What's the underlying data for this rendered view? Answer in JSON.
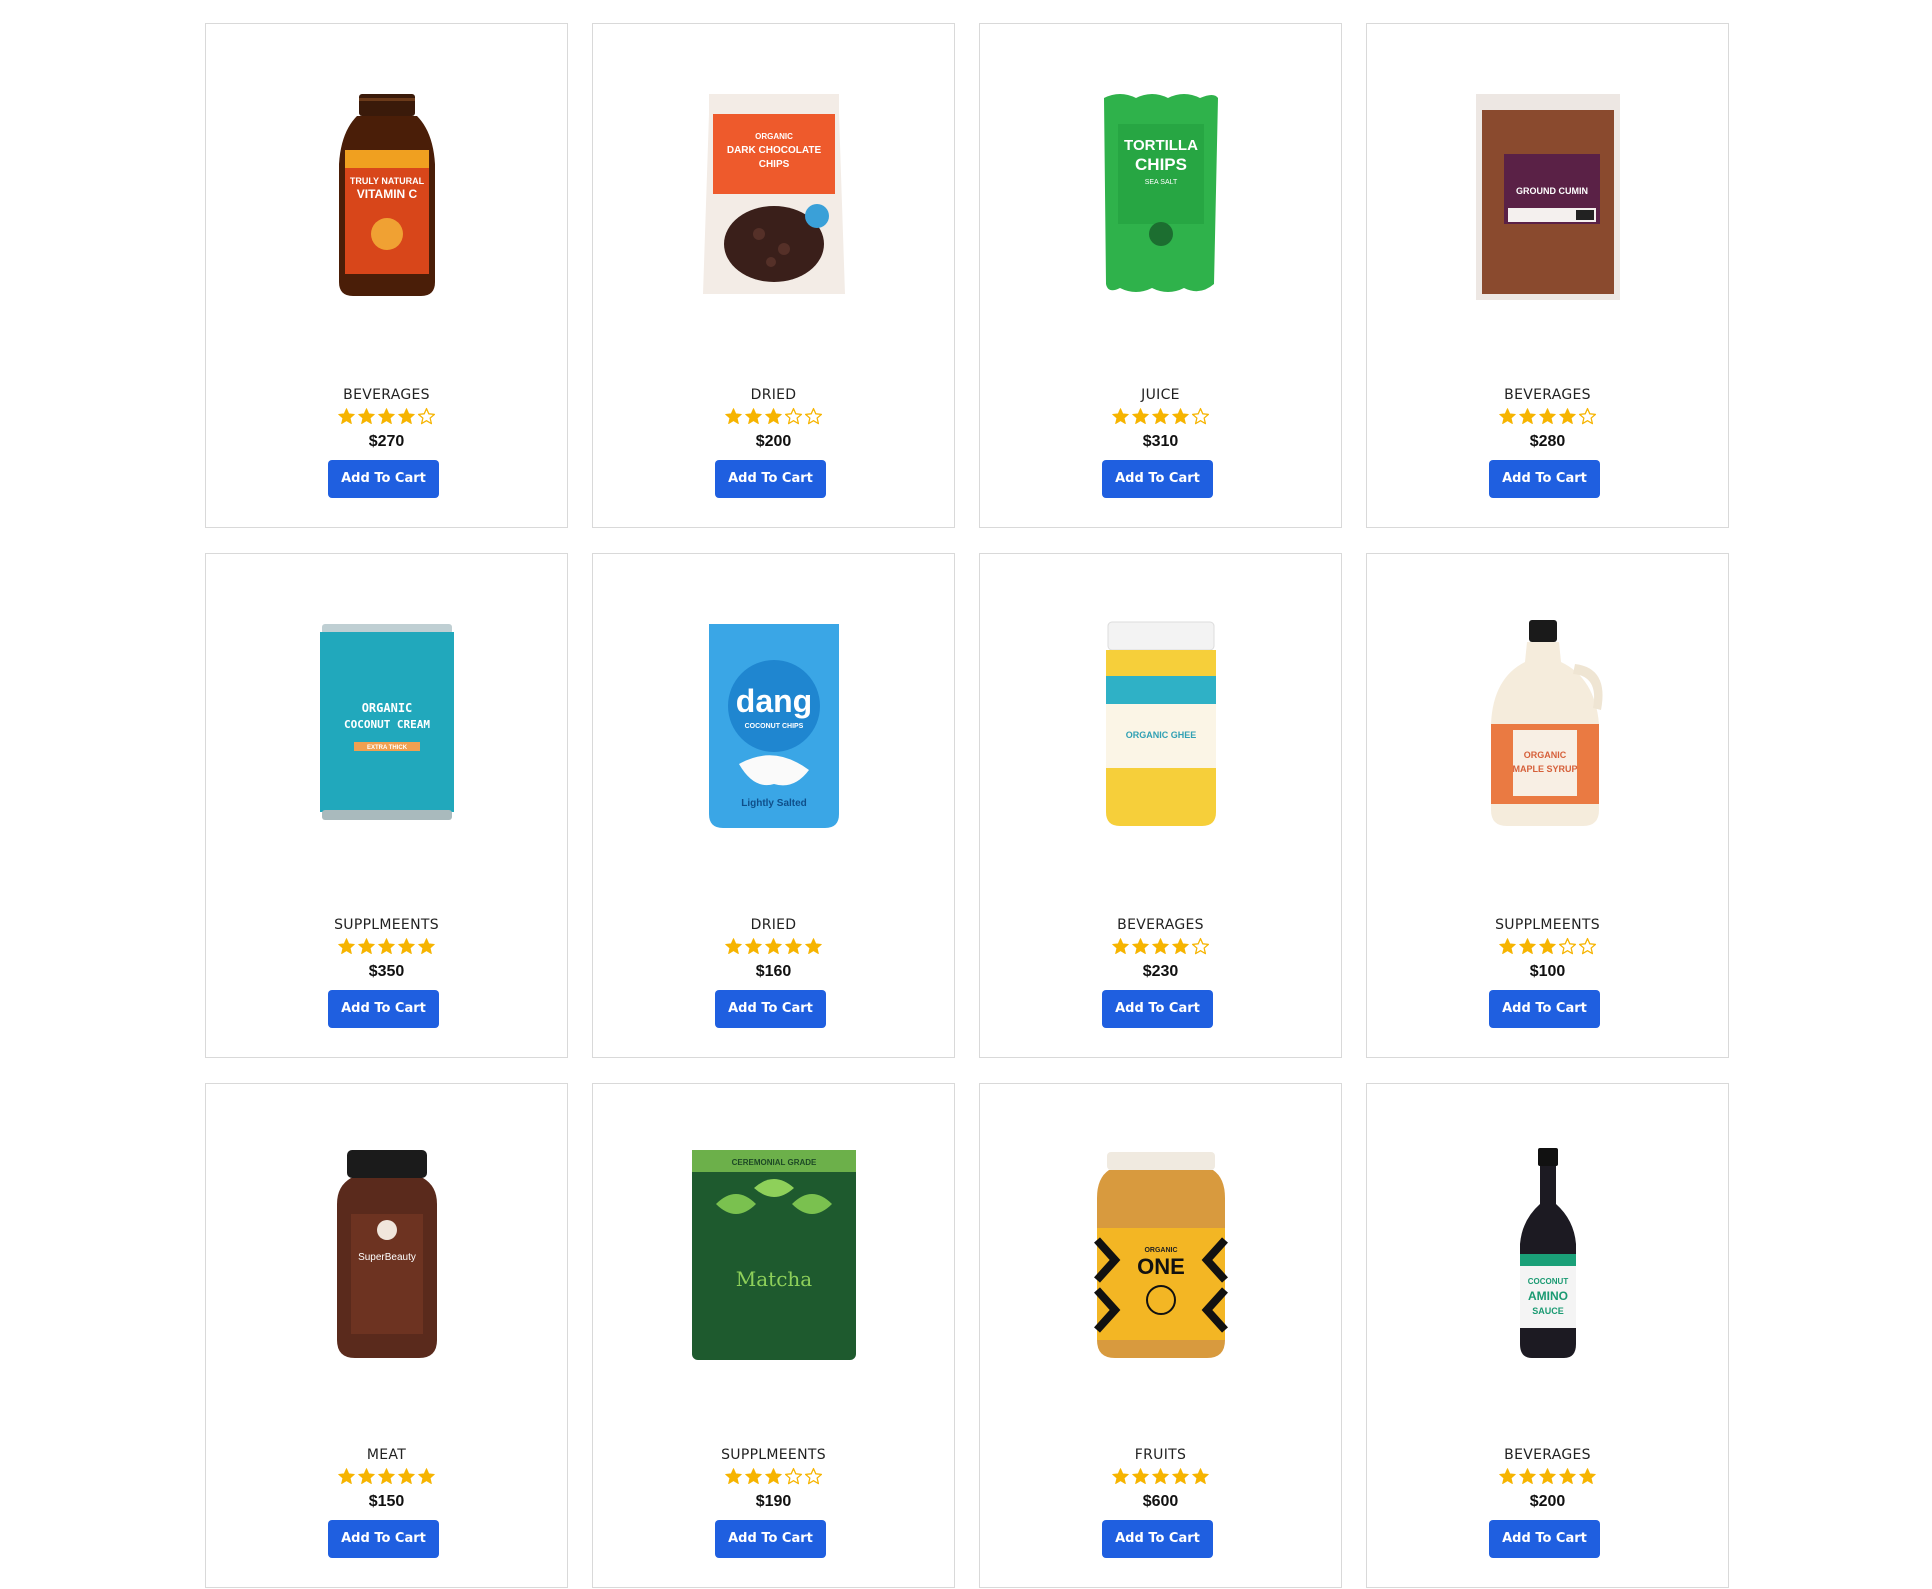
{
  "colors": {
    "button_bg": "#1f5fe0",
    "star_fill": "#f6b400",
    "card_border": "#d9d9d9"
  },
  "products": [
    {
      "category": "BEVERAGES",
      "rating": 4,
      "price": "$270",
      "button_label": "Add To Cart",
      "image": "vitamin-c-jar",
      "image_text": [
        "TRULY NATURAL",
        "VITAMIN C"
      ]
    },
    {
      "category": "DRIED",
      "rating": 3,
      "price": "$200",
      "button_label": "Add To Cart",
      "image": "dark-chocolate-chips-bag",
      "image_text": [
        "ORGANIC",
        "DARK CHOCOLATE",
        "CHIPS"
      ]
    },
    {
      "category": "JUICE",
      "rating": 4,
      "price": "$310",
      "button_label": "Add To Cart",
      "image": "tortilla-chips-bag",
      "image_text": [
        "TORTILLA",
        "CHIPS",
        "SEA SALT"
      ]
    },
    {
      "category": "BEVERAGES",
      "rating": 4,
      "price": "$280",
      "button_label": "Add To Cart",
      "image": "ground-cumin-bag",
      "image_text": [
        "GROUND CUMIN"
      ]
    },
    {
      "category": "SUPPLMEENTS",
      "rating": 5,
      "price": "$350",
      "button_label": "Add To Cart",
      "image": "coconut-cream-can",
      "image_text": [
        "ORGANIC",
        "COCONUT CREAM",
        "EXTRA THICK"
      ]
    },
    {
      "category": "DRIED",
      "rating": 5,
      "price": "$160",
      "button_label": "Add To Cart",
      "image": "dang-coconut-chips-bag",
      "image_text": [
        "dang",
        "COCONUT CHIPS",
        "Lightly Salted"
      ]
    },
    {
      "category": "BEVERAGES",
      "rating": 4,
      "price": "$230",
      "button_label": "Add To Cart",
      "image": "organic-ghee-jar",
      "image_text": [
        "ORGANIC GHEE"
      ]
    },
    {
      "category": "SUPPLMEENTS",
      "rating": 3,
      "price": "$100",
      "button_label": "Add To Cart",
      "image": "maple-syrup-jug",
      "image_text": [
        "ORGANIC",
        "MAPLE SYRUP"
      ]
    },
    {
      "category": "MEAT",
      "rating": 5,
      "price": "$150",
      "button_label": "Add To Cart",
      "image": "superbeauty-bottle",
      "image_text": [
        "SuperBeauty"
      ]
    },
    {
      "category": "SUPPLMEENTS",
      "rating": 3,
      "price": "$190",
      "button_label": "Add To Cart",
      "image": "matcha-pouch",
      "image_text": [
        "CEREMONIAL GRADE",
        "Matcha"
      ]
    },
    {
      "category": "FRUITS",
      "rating": 5,
      "price": "$600",
      "button_label": "Add To Cart",
      "image": "organic-honey-jar",
      "image_text": [
        "ORGANIC",
        "ONE"
      ]
    },
    {
      "category": "BEVERAGES",
      "rating": 5,
      "price": "$200",
      "button_label": "Add To Cart",
      "image": "coconut-amino-sauce-bottle",
      "image_text": [
        "COCONUT",
        "AMINO",
        "SAUCE"
      ]
    }
  ]
}
